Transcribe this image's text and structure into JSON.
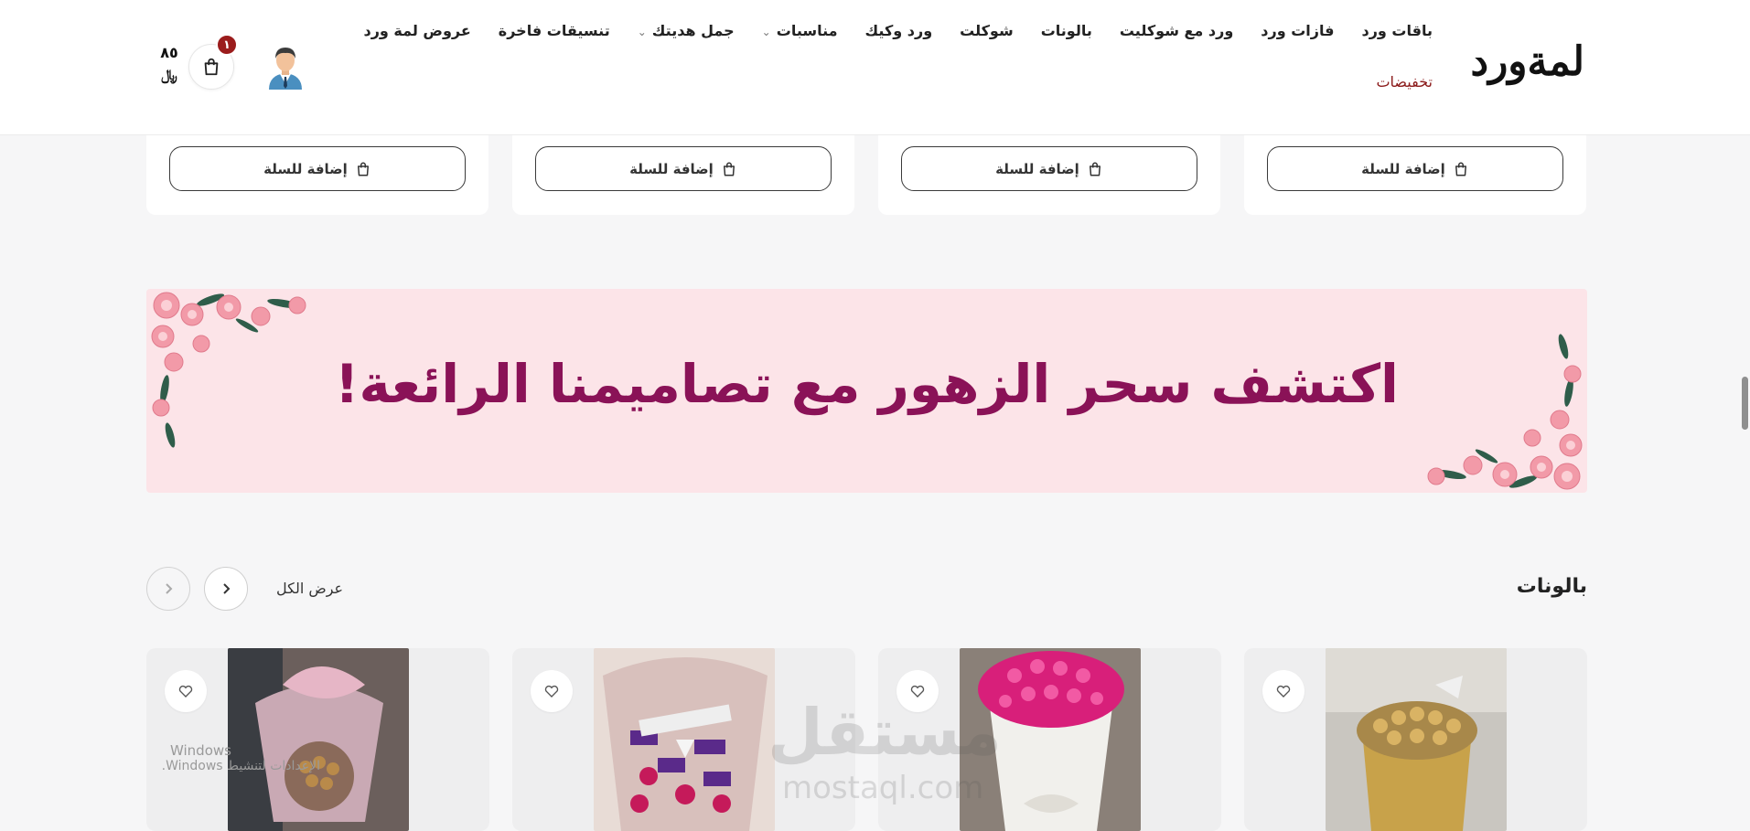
{
  "brand": {
    "logo": "لمةورد"
  },
  "nav": {
    "items": [
      {
        "label": "باقات ورد",
        "dropdown": false
      },
      {
        "label": "فازات ورد",
        "dropdown": false
      },
      {
        "label": "ورد مع شوكليت",
        "dropdown": false
      },
      {
        "label": "بالونات",
        "dropdown": false
      },
      {
        "label": "شوكلت",
        "dropdown": false
      },
      {
        "label": "ورد وكيك",
        "dropdown": false
      },
      {
        "label": "مناسبات",
        "dropdown": true
      },
      {
        "label": "جمل هديتك",
        "dropdown": true
      },
      {
        "label": "تنسيقات فاخرة",
        "dropdown": false
      },
      {
        "label": "عروض لمة ورد",
        "dropdown": false
      },
      {
        "label": "تخفيضات",
        "dropdown": false
      }
    ]
  },
  "cart": {
    "count": "١",
    "total": "٨٥",
    "currency": "﷼"
  },
  "product_actions": {
    "add_to_cart": "إضافة للسلة"
  },
  "banner": {
    "text": "اكتشف سحر الزهور مع تصاميمنا الرائعة!"
  },
  "section": {
    "title": "بالونات",
    "view_all": "عرض الكل"
  },
  "watermark": {
    "main": "مستقل",
    "sub": "mostaql.com"
  },
  "windows_activation": {
    "line1": "Windows",
    "line2": "الإعدادات لتنشيط Windows."
  },
  "colors": {
    "accent": "#8a1257",
    "discount": "#8b1a1a",
    "banner_bg": "#fce4e8",
    "badge": "#9b1c1c"
  },
  "icons": [
    "user-avatar-icon",
    "shopping-bag-icon",
    "heart-icon",
    "chevron-right-icon",
    "chevron-left-icon",
    "chevron-down-icon"
  ]
}
